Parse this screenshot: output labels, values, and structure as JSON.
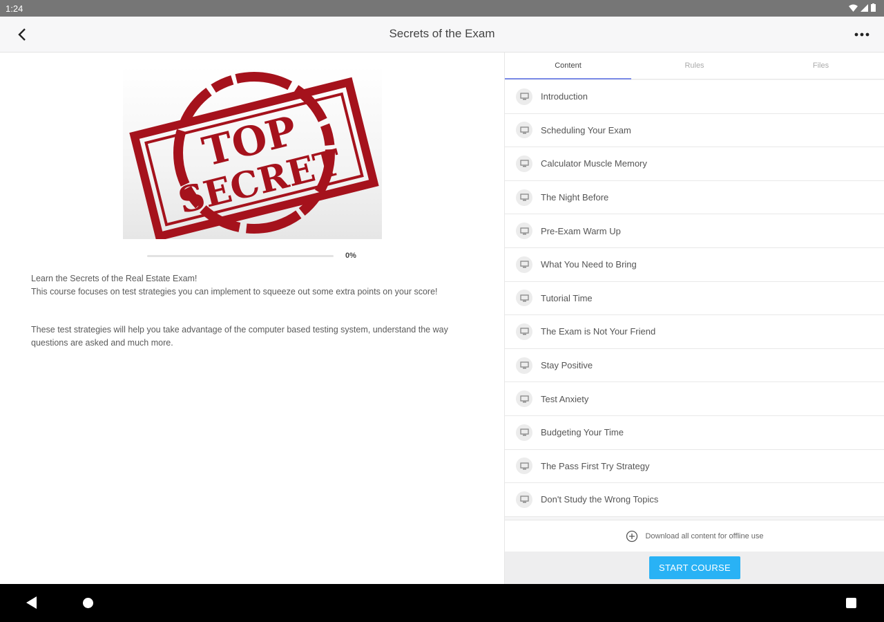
{
  "status_bar": {
    "time": "1:24"
  },
  "app_bar": {
    "title": "Secrets of the Exam"
  },
  "hero": {
    "stamp_line1": "TOP",
    "stamp_line2": "SECRET",
    "stamp_color": "#a5121c"
  },
  "progress": {
    "label": "0%",
    "value": 0
  },
  "description": {
    "line1": "Learn the Secrets of the Real Estate Exam!",
    "line2": "This course focuses on test strategies you can implement to squeeze out some extra points on your score!",
    "line3": "These test strategies will help you take advantage of the computer based testing system, understand the way questions are asked and much more."
  },
  "tabs": [
    {
      "label": "Content",
      "active": true
    },
    {
      "label": "Rules",
      "active": false
    },
    {
      "label": "Files",
      "active": false
    }
  ],
  "lessons": [
    {
      "label": "Introduction"
    },
    {
      "label": "Scheduling Your Exam"
    },
    {
      "label": "Calculator Muscle Memory"
    },
    {
      "label": "The Night Before"
    },
    {
      "label": "Pre-Exam Warm Up"
    },
    {
      "label": "What You Need to Bring"
    },
    {
      "label": "Tutorial Time"
    },
    {
      "label": "The Exam is Not Your Friend"
    },
    {
      "label": "Stay Positive"
    },
    {
      "label": "Test Anxiety"
    },
    {
      "label": "Budgeting Your Time"
    },
    {
      "label": "The Pass First Try Strategy"
    },
    {
      "label": "Don't Study the Wrong Topics"
    }
  ],
  "download": {
    "label": "Download all content for offline use"
  },
  "start_button": {
    "label": "START COURSE"
  },
  "colors": {
    "accent": "#29b2f5",
    "tab_indicator": "#7a8ae6"
  },
  "icons": {
    "back": "arrow-back-icon",
    "more": "more-horizontal-icon",
    "lesson": "monitor-icon",
    "download": "add-circle-icon"
  }
}
